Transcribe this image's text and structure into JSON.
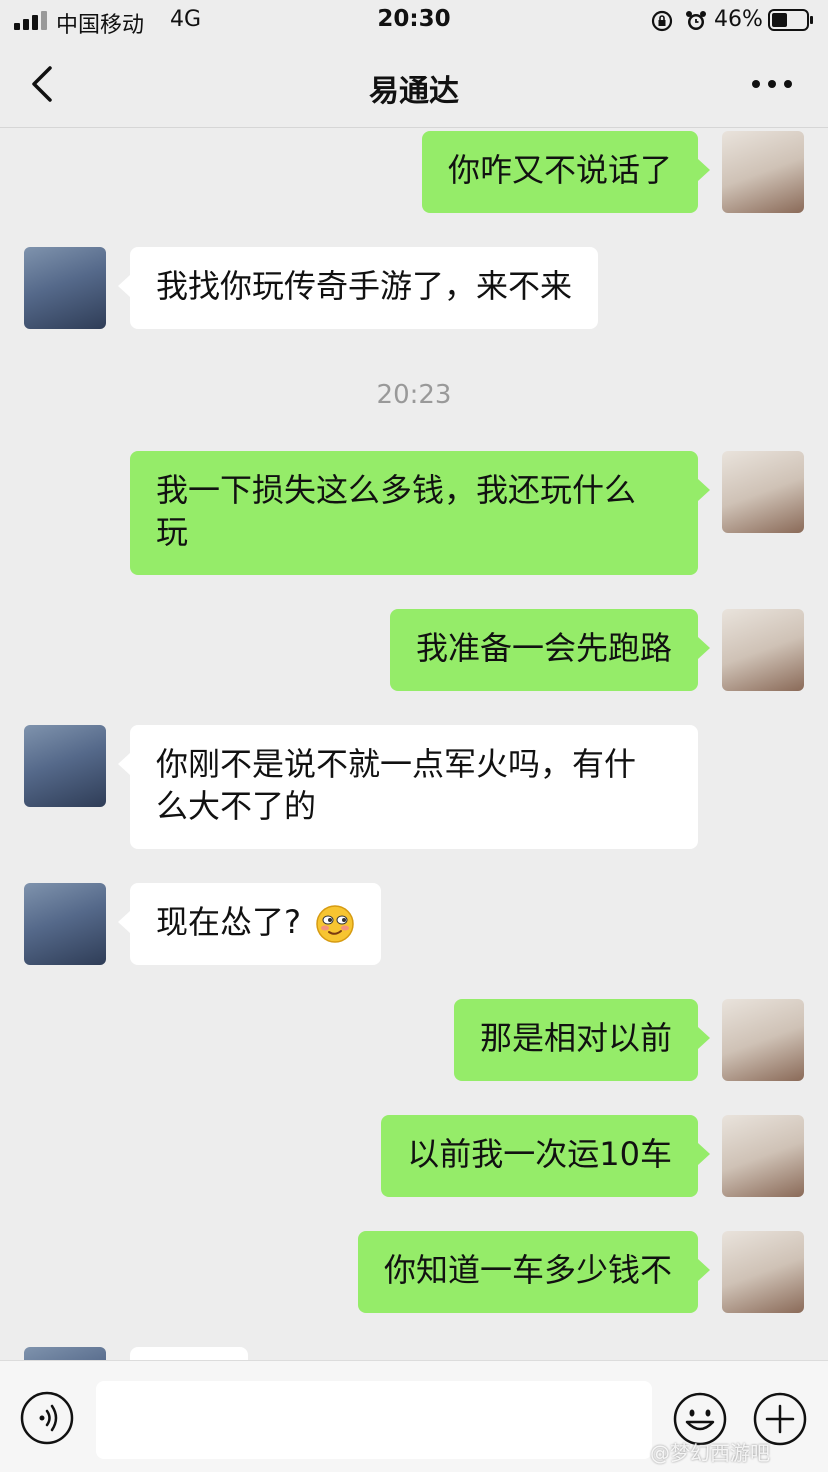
{
  "status_bar": {
    "carrier": "中国移动",
    "network": "4G",
    "time": "20:30",
    "battery": "46%",
    "battery_level": 0.46
  },
  "nav": {
    "title": "易通达"
  },
  "chat": {
    "timestamp": "20:23",
    "messages": [
      {
        "from": "self",
        "text": "你咋又不说话了"
      },
      {
        "from": "other",
        "text": "我找你玩传奇手游了，来不来"
      },
      {
        "from": "self",
        "text_line1": "我一下损失这么多钱，我还玩什么",
        "text_line2": "玩"
      },
      {
        "from": "self",
        "text": "我准备一会先跑路"
      },
      {
        "from": "other",
        "text_line1": "你刚不是说不就一点军火吗，有什",
        "text_line2": "么大不了的"
      },
      {
        "from": "other",
        "text": "现在怂了?"
      },
      {
        "from": "self",
        "text": "那是相对以前"
      },
      {
        "from": "self",
        "text": "以前我一次运10车"
      },
      {
        "from": "self",
        "text": "你知道一车多少钱不"
      }
    ]
  },
  "watermark": "@梦幻西游吧",
  "icons": {
    "back": "chevron-left-icon",
    "more": "more-dots-icon",
    "voice": "voice-icon",
    "emoji": "emoji-icon",
    "plus": "plus-icon"
  }
}
